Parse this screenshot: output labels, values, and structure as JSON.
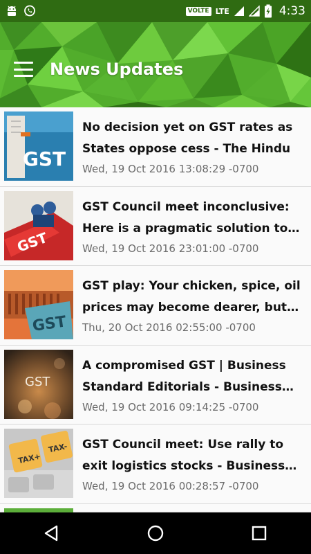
{
  "status_bar": {
    "volte": "VOLTE",
    "network": "LTE",
    "time": "4:33",
    "icons": [
      "android-icon",
      "whatsapp-icon",
      "signal-icon",
      "signal-icon",
      "battery-charging-icon"
    ]
  },
  "header": {
    "title": "News Updates",
    "menu_icon": "hamburger-menu-icon",
    "accent_color": "#4ea82a"
  },
  "news": [
    {
      "title": "No decision yet on GST rates as States oppose cess - The Hindu",
      "date": "Wed, 19 Oct 2016 13:08:29 -0700",
      "thumb_caption": "GST"
    },
    {
      "title": "GST Council meet inconclusive: Here is a pragmatic solution to end the ...",
      "date": "Wed, 19 Oct 2016 23:01:00 -0700",
      "thumb_caption": "GST"
    },
    {
      "title": "GST play: Your chicken, spice, oil prices may become dearer, but che...",
      "date": "Thu, 20 Oct 2016 02:55:00 -0700",
      "thumb_caption": "GST"
    },
    {
      "title": "A compromised GST | Business Standard Editorials - Business Sta...",
      "date": "Wed, 19 Oct 2016 09:14:25 -0700",
      "thumb_caption": "GST"
    },
    {
      "title": "GST Council meet: Use rally to exit logistics stocks - Business Standard",
      "date": "Wed, 19 Oct 2016 00:28:57 -0700",
      "thumb_caption_left": "TAX+",
      "thumb_caption_right": "TAX-"
    }
  ],
  "nav": {
    "back": "back-triangle-icon",
    "home": "home-circle-icon",
    "recents": "recents-square-icon"
  }
}
